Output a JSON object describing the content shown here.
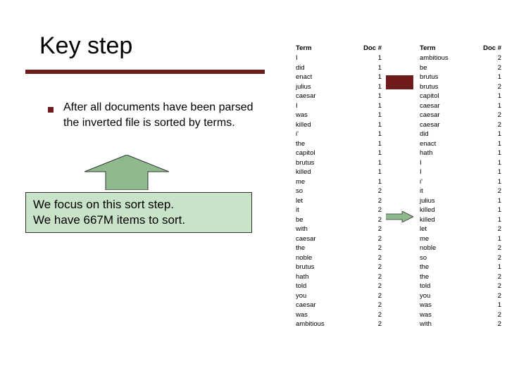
{
  "title": "Key step",
  "body": "After all documents have been parsed the inverted file is sorted by terms.",
  "callout_line1": "We focus on this sort step.",
  "callout_line2": "We have 667M items to sort.",
  "headers": {
    "term": "Term",
    "doc": "Doc #"
  },
  "left_rows": [
    {
      "t": "I",
      "d": "1"
    },
    {
      "t": "did",
      "d": "1"
    },
    {
      "t": "enact",
      "d": "1"
    },
    {
      "t": "julius",
      "d": "1"
    },
    {
      "t": "caesar",
      "d": "1"
    },
    {
      "t": "I",
      "d": "1"
    },
    {
      "t": "was",
      "d": "1"
    },
    {
      "t": "killed",
      "d": "1"
    },
    {
      "t": "i'",
      "d": "1"
    },
    {
      "t": "the",
      "d": "1"
    },
    {
      "t": "capitol",
      "d": "1"
    },
    {
      "t": "brutus",
      "d": "1"
    },
    {
      "t": "killed",
      "d": "1"
    },
    {
      "t": "me",
      "d": "1"
    },
    {
      "t": "so",
      "d": "2"
    },
    {
      "t": "let",
      "d": "2"
    },
    {
      "t": "it",
      "d": "2"
    },
    {
      "t": "be",
      "d": "2"
    },
    {
      "t": "with",
      "d": "2"
    },
    {
      "t": "caesar",
      "d": "2"
    },
    {
      "t": "the",
      "d": "2"
    },
    {
      "t": "noble",
      "d": "2"
    },
    {
      "t": "brutus",
      "d": "2"
    },
    {
      "t": "hath",
      "d": "2"
    },
    {
      "t": "told",
      "d": "2"
    },
    {
      "t": "you",
      "d": "2"
    },
    {
      "t": "caesar",
      "d": "2"
    },
    {
      "t": "was",
      "d": "2"
    },
    {
      "t": "ambitious",
      "d": "2"
    }
  ],
  "right_rows": [
    {
      "t": "ambitious",
      "d": "2"
    },
    {
      "t": "be",
      "d": "2"
    },
    {
      "t": "brutus",
      "d": "1"
    },
    {
      "t": "brutus",
      "d": "2"
    },
    {
      "t": "capitol",
      "d": "1"
    },
    {
      "t": "caesar",
      "d": "1"
    },
    {
      "t": "caesar",
      "d": "2"
    },
    {
      "t": "caesar",
      "d": "2"
    },
    {
      "t": "did",
      "d": "1"
    },
    {
      "t": "enact",
      "d": "1"
    },
    {
      "t": "hath",
      "d": "1"
    },
    {
      "t": "I",
      "d": "1"
    },
    {
      "t": "I",
      "d": "1"
    },
    {
      "t": "i'",
      "d": "1"
    },
    {
      "t": "it",
      "d": "2"
    },
    {
      "t": "julius",
      "d": "1"
    },
    {
      "t": "killed",
      "d": "1"
    },
    {
      "t": "killed",
      "d": "1"
    },
    {
      "t": "let",
      "d": "2"
    },
    {
      "t": "me",
      "d": "1"
    },
    {
      "t": "noble",
      "d": "2"
    },
    {
      "t": "so",
      "d": "2"
    },
    {
      "t": "the",
      "d": "1"
    },
    {
      "t": "the",
      "d": "2"
    },
    {
      "t": "told",
      "d": "2"
    },
    {
      "t": "you",
      "d": "2"
    },
    {
      "t": "was",
      "d": "1"
    },
    {
      "t": "was",
      "d": "2"
    },
    {
      "t": "with",
      "d": "2"
    }
  ]
}
